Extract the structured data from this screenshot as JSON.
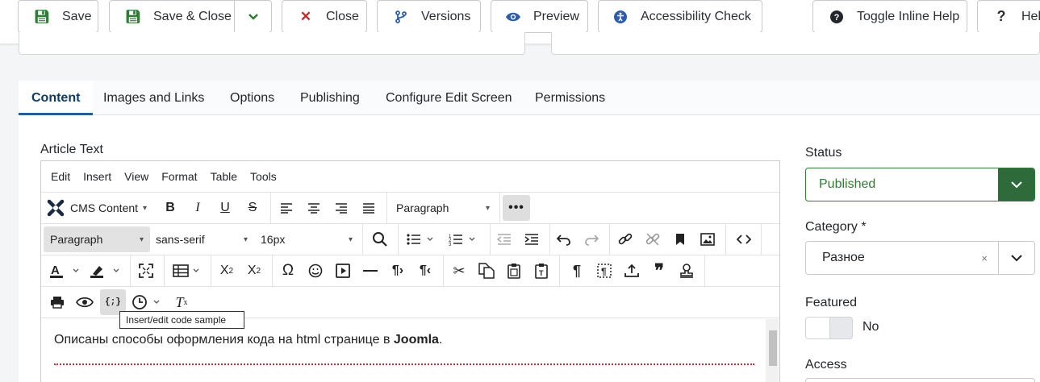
{
  "toolbar": {
    "save": "Save",
    "save_close": "Save & Close",
    "close": "Close",
    "versions": "Versions",
    "preview": "Preview",
    "accessibility": "Accessibility Check",
    "toggle_help": "Toggle Inline Help",
    "help": "Help"
  },
  "tabs": [
    "Content",
    "Images and Links",
    "Options",
    "Publishing",
    "Configure Edit Screen",
    "Permissions"
  ],
  "article_text_label": "Article Text",
  "editor": {
    "menu": [
      "Edit",
      "Insert",
      "View",
      "Format",
      "Table",
      "Tools"
    ],
    "cms_content": "CMS Content",
    "block_format_1": "Paragraph",
    "block_format_2": "Paragraph",
    "font_family": "sans-serif",
    "font_size": "16px",
    "tooltip": "Insert/edit code sample",
    "body_prefix": "Описаны способы оформления кода на html странице в ",
    "body_bold": "Joomla",
    "body_suffix": "."
  },
  "sidebar": {
    "status_label": "Status",
    "status_value": "Published",
    "category_label": "Category *",
    "category_value": "Разное",
    "featured_label": "Featured",
    "featured_value": "No",
    "access_label": "Access"
  },
  "colors": {
    "published": "#2f7d32",
    "accent": "#1f5fa6"
  }
}
